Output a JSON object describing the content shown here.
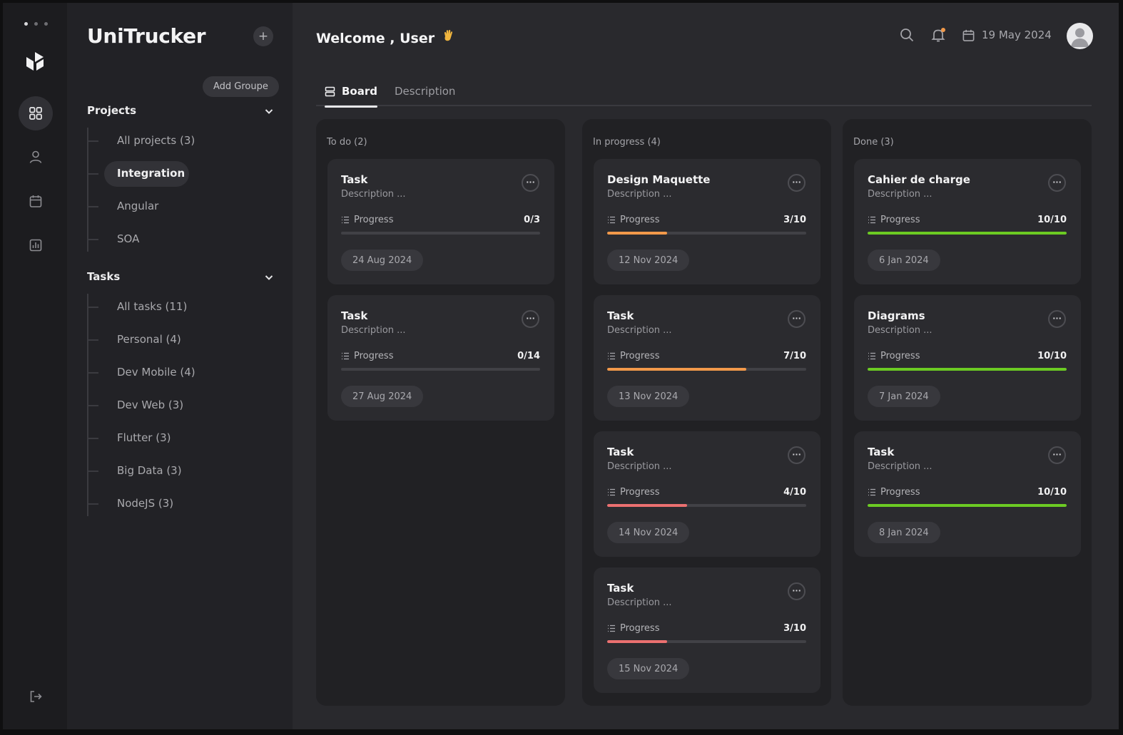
{
  "app": {
    "name": "UniTrucker"
  },
  "sidebar": {
    "add_group_label": "Add Groupe",
    "projects_title": "Projects",
    "projects": [
      {
        "label": "All projects (3)"
      },
      {
        "label": "Integration",
        "selected": true
      },
      {
        "label": "Angular"
      },
      {
        "label": "SOA"
      }
    ],
    "tasks_title": "Tasks",
    "tasks": [
      {
        "label": "All tasks (11)"
      },
      {
        "label": "Personal (4)"
      },
      {
        "label": "Dev Mobile (4)"
      },
      {
        "label": "Dev Web (3)"
      },
      {
        "label": "Flutter (3)"
      },
      {
        "label": "Big Data (3)"
      },
      {
        "label": "NodeJS (3)"
      }
    ]
  },
  "header": {
    "welcome": "Welcome , User",
    "wave_icon": "waving-hand-icon",
    "date": "19 May 2024"
  },
  "tabs": [
    {
      "label": "Board",
      "active": true
    },
    {
      "label": "Description",
      "active": false
    }
  ],
  "colors": {
    "orange": "#f2994a",
    "red": "#eb7070",
    "green": "#6ccb23"
  },
  "board": {
    "columns": [
      {
        "title": "To do (2)",
        "cards": [
          {
            "title": "Task",
            "description": "Description ...",
            "progress_label": "Progress",
            "progress_text": "0/3",
            "done": 0,
            "total": 3,
            "color": "#4a4a4f",
            "date": "24 Aug 2024"
          },
          {
            "title": "Task",
            "description": "Description ...",
            "progress_label": "Progress",
            "progress_text": "0/14",
            "done": 0,
            "total": 14,
            "color": "#4a4a4f",
            "date": "27 Aug 2024"
          }
        ]
      },
      {
        "title": "In progress (4)",
        "cards": [
          {
            "title": "Design Maquette",
            "description": "Description ...",
            "progress_label": "Progress",
            "progress_text": "3/10",
            "done": 3,
            "total": 10,
            "color": "#f2994a",
            "date": "12 Nov 2024"
          },
          {
            "title": "Task",
            "description": "Description ...",
            "progress_label": "Progress",
            "progress_text": "7/10",
            "done": 7,
            "total": 10,
            "color": "#f2994a",
            "date": "13 Nov 2024"
          },
          {
            "title": "Task",
            "description": "Description ...",
            "progress_label": "Progress",
            "progress_text": "4/10",
            "done": 4,
            "total": 10,
            "color": "#eb7070",
            "date": "14 Nov 2024"
          },
          {
            "title": "Task",
            "description": "Description ...",
            "progress_label": "Progress",
            "progress_text": "3/10",
            "done": 3,
            "total": 10,
            "color": "#eb7070",
            "date": "15 Nov 2024"
          }
        ]
      },
      {
        "title": "Done (3)",
        "cards": [
          {
            "title": "Cahier de charge",
            "description": "Description ...",
            "progress_label": "Progress",
            "progress_text": "10/10",
            "done": 10,
            "total": 10,
            "color": "#6ccb23",
            "date": "6 Jan 2024"
          },
          {
            "title": "Diagrams",
            "description": "Description ...",
            "progress_label": "Progress",
            "progress_text": "10/10",
            "done": 10,
            "total": 10,
            "color": "#6ccb23",
            "date": "7 Jan 2024"
          },
          {
            "title": "Task",
            "description": "Description ...",
            "progress_label": "Progress",
            "progress_text": "10/10",
            "done": 10,
            "total": 10,
            "color": "#6ccb23",
            "date": "8 Jan 2024"
          }
        ]
      }
    ]
  }
}
